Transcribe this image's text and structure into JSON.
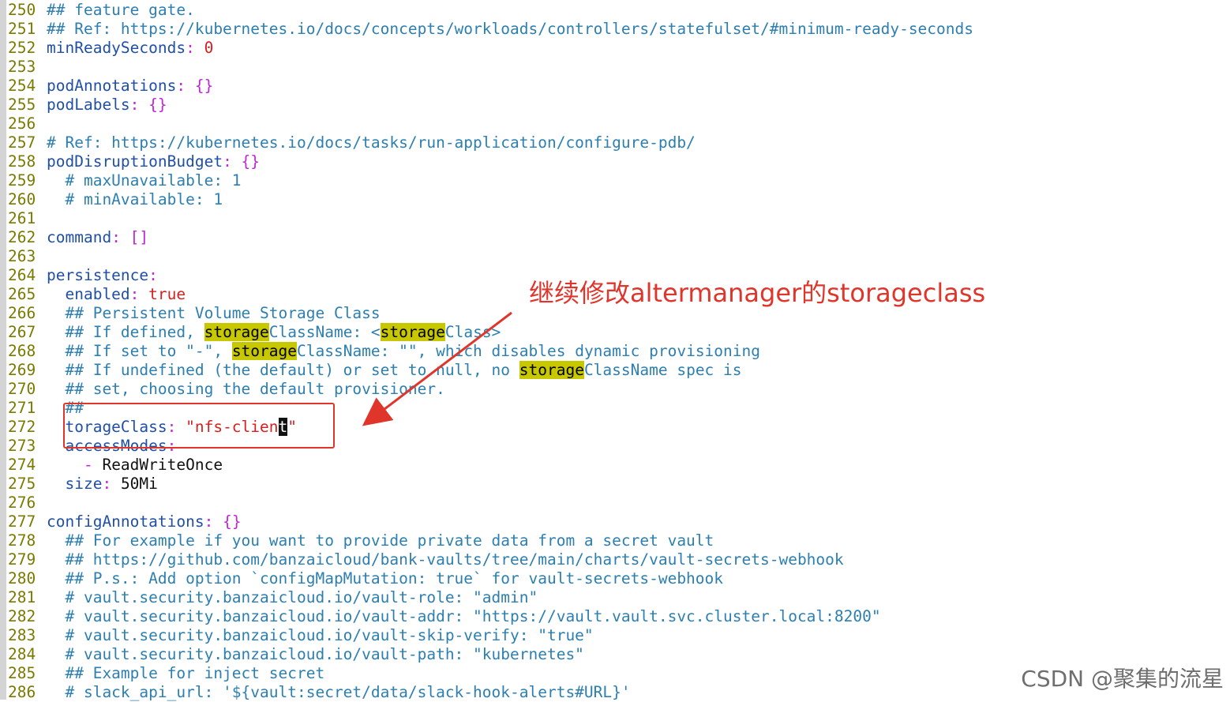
{
  "annotation": "继续修改altermanager的storageclass",
  "watermark": "CSDN @聚集的流星",
  "colors": {
    "annotation_red": "#e0352b",
    "highlight": "#c8c800"
  },
  "lines": [
    {
      "n": "250",
      "t": "## feature gate."
    },
    {
      "n": "251",
      "t": "## Ref: https://kubernetes.io/docs/concepts/workloads/controllers/statefulset/#minimum-ready-seconds"
    },
    {
      "n": "252",
      "k": "minReadySeconds",
      "v": "0"
    },
    {
      "n": "253"
    },
    {
      "n": "254",
      "k": "podAnnotations",
      "v": "{}"
    },
    {
      "n": "255",
      "k": "podLabels",
      "v": "{}"
    },
    {
      "n": "256"
    },
    {
      "n": "257",
      "t": "# Ref: https://kubernetes.io/docs/tasks/run-application/configure-pdb/"
    },
    {
      "n": "258",
      "k": "podDisruptionBudget",
      "v": "{}"
    },
    {
      "n": "259",
      "t": "  # maxUnavailable: 1"
    },
    {
      "n": "260",
      "t": "  # minAvailable: 1"
    },
    {
      "n": "261"
    },
    {
      "n": "262",
      "k": "command",
      "v": "[]"
    },
    {
      "n": "263"
    },
    {
      "n": "264",
      "k": "persistence",
      "v": ""
    },
    {
      "n": "265",
      "k": "  enabled",
      "v": "true"
    },
    {
      "n": "266",
      "t": "  ## Persistent Volume Storage Class"
    },
    {
      "n": "267",
      "t1": "  ## If defined, ",
      "h1": "storage",
      "t2": "ClassName: <",
      "h2": "storage",
      "t3": "Class>"
    },
    {
      "n": "268",
      "t1": "  ## If set to \"-\", ",
      "h1": "storage",
      "t2": "ClassName: \"\", which disables dynamic provisioning"
    },
    {
      "n": "269",
      "t1": "  ## If undefined (the default) or set to null, no ",
      "h1": "storage",
      "t2": "ClassName spec is"
    },
    {
      "n": "270",
      "t": "  ## set, choosing the default provisioner."
    },
    {
      "n": "271",
      "t": "  ##"
    },
    {
      "n": "272",
      "k": "  torageClass",
      "s1": "\"nfs-clien",
      "cur": "t",
      "s2": "\""
    },
    {
      "n": "273",
      "k": "  accessModes",
      "v": ""
    },
    {
      "n": "274",
      "dash": "    - ",
      "plain": "ReadWriteOnce"
    },
    {
      "n": "275",
      "k": "  size",
      "plain": "50Mi"
    },
    {
      "n": "276"
    },
    {
      "n": "277",
      "k": "configAnnotations",
      "v": "{}"
    },
    {
      "n": "278",
      "t": "  ## For example if you want to provide private data from a secret vault"
    },
    {
      "n": "279",
      "t": "  ## https://github.com/banzaicloud/bank-vaults/tree/main/charts/vault-secrets-webhook"
    },
    {
      "n": "280",
      "t": "  ## P.s.: Add option `configMapMutation: true` for vault-secrets-webhook"
    },
    {
      "n": "281",
      "t": "  # vault.security.banzaicloud.io/vault-role: \"admin\""
    },
    {
      "n": "282",
      "t": "  # vault.security.banzaicloud.io/vault-addr: \"https://vault.vault.svc.cluster.local:8200\""
    },
    {
      "n": "283",
      "t": "  # vault.security.banzaicloud.io/vault-skip-verify: \"true\""
    },
    {
      "n": "284",
      "t": "  # vault.security.banzaicloud.io/vault-path: \"kubernetes\""
    },
    {
      "n": "285",
      "t": "  ## Example for inject secret"
    },
    {
      "n": "286",
      "t": "  # slack_api_url: '${vault:secret/data/slack-hook-alerts#URL}'"
    }
  ]
}
